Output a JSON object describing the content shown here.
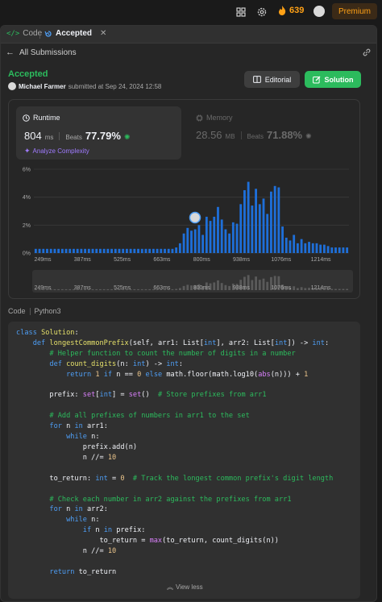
{
  "topbar": {
    "streak_count": "639",
    "premium_label": "Premium",
    "icons": [
      "layout-icon",
      "gear-icon",
      "fire-icon",
      "avatar"
    ]
  },
  "tabs": {
    "code_label": "Code",
    "accepted_label": "Accepted",
    "close_glyph": "✕"
  },
  "nav": {
    "all_submissions": "All Submissions"
  },
  "submission": {
    "status": "Accepted",
    "user": "Michael Farmer",
    "submitted_text": "submitted at Sep 24, 2024 12:58",
    "editorial_label": "Editorial",
    "solution_label": "Solution"
  },
  "runtime": {
    "label": "Runtime",
    "value": "804",
    "unit": "ms",
    "beats_label": "Beats",
    "beats_pct": "77.79%",
    "analyze_label": "Analyze Complexity"
  },
  "memory": {
    "label": "Memory",
    "value": "28.56",
    "unit": "MB",
    "beats_label": "Beats",
    "beats_pct": "71.88%"
  },
  "chart_data": {
    "type": "bar",
    "y_ticks": [
      "6%",
      "4%",
      "2%",
      "0%"
    ],
    "y_tick_values": [
      6,
      4,
      2,
      0
    ],
    "ylim": [
      0,
      6
    ],
    "x_ticks": [
      "249ms",
      "387ms",
      "525ms",
      "663ms",
      "800ms",
      "938ms",
      "1076ms",
      "1214ms"
    ],
    "values": [
      0.3,
      0.3,
      0.3,
      0.3,
      0.3,
      0.3,
      0.3,
      0.3,
      0.3,
      0.3,
      0.3,
      0.3,
      0.3,
      0.3,
      0.3,
      0.3,
      0.3,
      0.3,
      0.3,
      0.3,
      0.3,
      0.3,
      0.3,
      0.3,
      0.3,
      0.3,
      0.3,
      0.3,
      0.3,
      0.3,
      0.3,
      0.3,
      0.3,
      0.3,
      0.3,
      0.3,
      0.3,
      0.4,
      0.7,
      1.4,
      1.8,
      1.6,
      1.7,
      2.0,
      1.3,
      2.6,
      2.3,
      2.6,
      3.3,
      2.4,
      1.7,
      1.4,
      2.2,
      2.1,
      3.5,
      4.5,
      5.1,
      3.4,
      4.6,
      3.5,
      3.9,
      2.8,
      4.4,
      4.8,
      4.7,
      1.9,
      1.1,
      0.9,
      1.3,
      0.7,
      1.0,
      0.7,
      0.8,
      0.7,
      0.7,
      0.6,
      0.6,
      0.5,
      0.4,
      0.4,
      0.4,
      0.4,
      0.4
    ],
    "highlight_marker": "user-avatar-marker",
    "bar_color": "#1e6fd9",
    "grid": true
  },
  "code": {
    "header_label": "Code",
    "language": "Python3",
    "view_less": "View less"
  }
}
